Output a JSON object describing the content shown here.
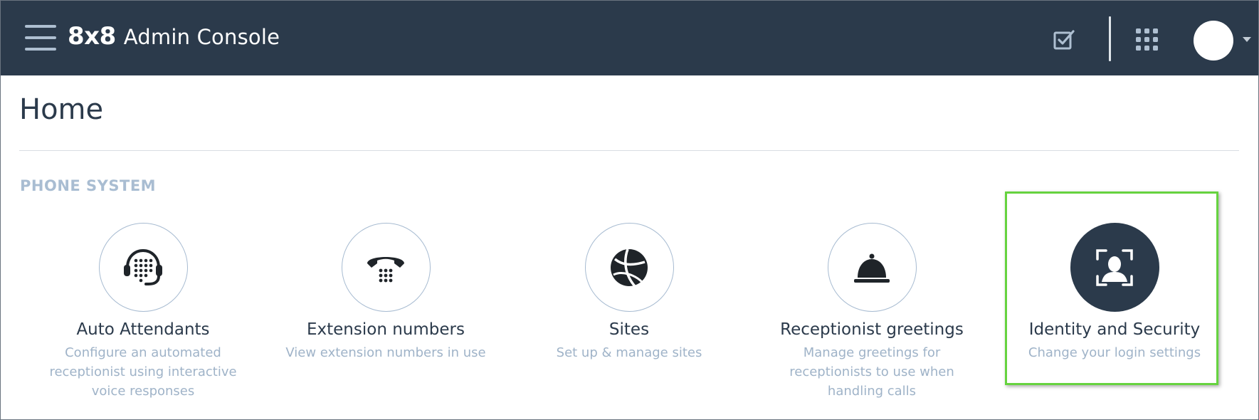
{
  "header": {
    "logo": "8x8",
    "title": "Admin Console",
    "icons": {
      "menu": "hamburger-icon",
      "tasks": "checkbox-icon",
      "apps": "grid-icon",
      "avatar": "avatar",
      "caret": "chevron-down-icon"
    }
  },
  "page": {
    "title": "Home"
  },
  "section": {
    "label": "PHONE SYSTEM"
  },
  "cards": [
    {
      "title": "Auto Attendants",
      "desc": "Configure an automated receptionist using interactive voice responses",
      "icon": "headset-icon"
    },
    {
      "title": "Extension numbers",
      "desc": "View extension numbers in use",
      "icon": "phone-keypad-icon"
    },
    {
      "title": "Sites",
      "desc": "Set up & manage sites",
      "icon": "globe-icon"
    },
    {
      "title": "Receptionist greetings",
      "desc": "Manage greetings for receptionists to use when handling calls",
      "icon": "service-bell-icon"
    },
    {
      "title": "Identity and Security",
      "desc": "Change your login settings",
      "icon": "face-scan-icon",
      "selected": true
    }
  ],
  "colors": {
    "header_bg": "#2b3a4b",
    "accent_muted": "#a9bdd2",
    "highlight": "#66d33f"
  }
}
